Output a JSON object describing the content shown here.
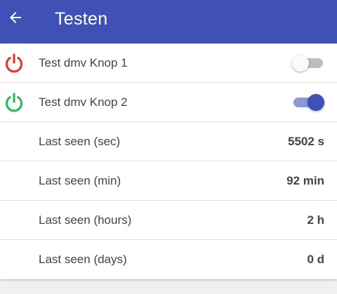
{
  "header": {
    "title": "Testen",
    "back_icon": "arrow-left-icon",
    "background": "#3f51b5"
  },
  "rows": [
    {
      "label": "Test dmv Knop 1",
      "icon": "power-icon",
      "icon_color": "#e53935",
      "switch_on": false
    },
    {
      "label": "Test dmv Knop 2",
      "icon": "power-icon",
      "icon_color": "#2ebd59",
      "switch_on": true
    },
    {
      "label": "Last seen (sec)",
      "value": "5502 s"
    },
    {
      "label": "Last seen (min)",
      "value": "92 min"
    },
    {
      "label": "Last seen (hours)",
      "value": "2 h"
    },
    {
      "label": "Last seen (days)",
      "value": "0 d"
    }
  ],
  "colors": {
    "accent": "#3f51b5",
    "power_off": "#e53935",
    "power_on": "#2ebd59"
  }
}
